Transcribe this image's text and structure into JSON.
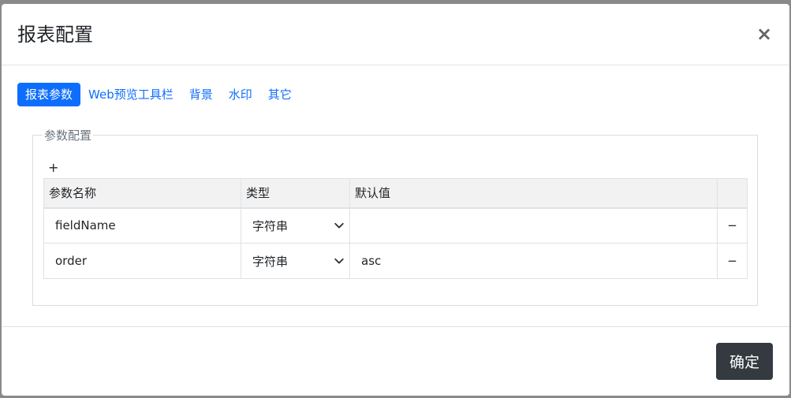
{
  "modal": {
    "title": "报表配置",
    "close_glyph": "×",
    "close_icon": "close-icon"
  },
  "tabs": [
    {
      "label": "报表参数",
      "active": true
    },
    {
      "label": "Web预览工具栏",
      "active": false
    },
    {
      "label": "背景",
      "active": false
    },
    {
      "label": "水印",
      "active": false
    },
    {
      "label": "其它",
      "active": false
    }
  ],
  "params_section": {
    "legend": "参数配置",
    "add_glyph": "+",
    "columns": [
      "参数名称",
      "类型",
      "默认值",
      ""
    ],
    "rows": [
      {
        "name": "fieldName",
        "type": "字符串",
        "default": "",
        "remove_glyph": "−"
      },
      {
        "name": "order",
        "type": "字符串",
        "default": "asc",
        "remove_glyph": "−"
      }
    ]
  },
  "footer": {
    "confirm_label": "确定"
  },
  "colors": {
    "accent": "#0d6efd",
    "confirm_bg": "#343a40"
  }
}
